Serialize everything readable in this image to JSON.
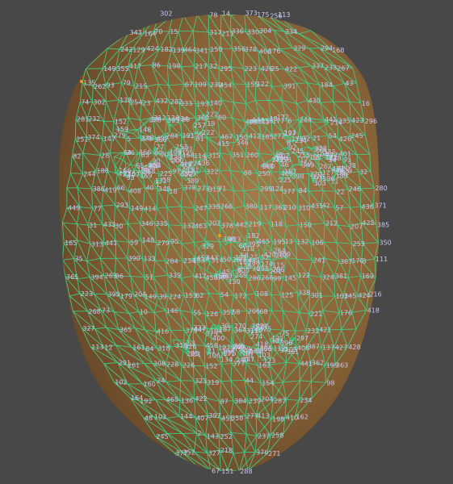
{
  "viewport": {
    "name": "3D face mesh viewport",
    "background": "#484848",
    "mesh_color": "#3fd08a",
    "skin_color": "#8a6438",
    "label_color": "#c9c6f2"
  },
  "vertex_labels": [
    "109",
    "10",
    "338",
    "67",
    "297",
    "103",
    "69",
    "108",
    "151",
    "337",
    "299",
    "332",
    "54",
    "104",
    "333",
    "284",
    "68",
    "105",
    "66",
    "107",
    "9",
    "336",
    "296",
    "334",
    "298",
    "63",
    "52",
    "65",
    "55",
    "8",
    "285",
    "295",
    "282",
    "293",
    "21",
    "71",
    "70",
    "46",
    "53",
    "222",
    "221",
    "193",
    "168",
    "417",
    "441",
    "442",
    "443",
    "444",
    "301",
    "251",
    "162",
    "139",
    "156",
    "124",
    "225",
    "224",
    "223",
    "351",
    "419",
    "413",
    "441",
    "286",
    "258",
    "257",
    "260",
    "467",
    "389",
    "127",
    "143",
    "35",
    "226",
    "113",
    "188",
    "122",
    "6",
    "197",
    "412",
    "465",
    "357",
    "453",
    "359",
    "264",
    "340",
    "356",
    "234",
    "227",
    "111",
    "117",
    "118",
    "50",
    "101",
    "36",
    "205",
    "142",
    "203",
    "126",
    "198",
    "195",
    "5",
    "4",
    "281",
    "274",
    "93",
    "123",
    "137",
    "177",
    "215",
    "147",
    "187",
    "207",
    "206",
    "216",
    "92",
    "165",
    "167",
    "164",
    "393",
    "391",
    "322",
    "132",
    "58",
    "138",
    "192",
    "214",
    "212",
    "186",
    "57",
    "43",
    "202",
    "210",
    "204",
    "194",
    "211",
    "169",
    "170",
    "140",
    "172",
    "136",
    "135",
    "150",
    "149",
    "176",
    "148",
    "152",
    "377",
    "400",
    "378",
    "379",
    "365",
    "397",
    "288",
    "361",
    "323",
    "454",
    "447",
    "366",
    "376",
    "401",
    "433",
    "435",
    "416",
    "364",
    "367",
    "434",
    "430",
    "431",
    "394",
    "395",
    "369",
    "396",
    "175",
    "171",
    "199",
    "200",
    "18",
    "313",
    "421",
    "418",
    "424",
    "422",
    "273",
    "335",
    "406",
    "262",
    "428",
    "32",
    "208",
    "201",
    "83",
    "182",
    "106",
    "84",
    "17",
    "314",
    "405",
    "321",
    "375",
    "291",
    "287",
    "410",
    "436",
    "427",
    "411",
    "425",
    "426",
    "266",
    "423",
    "280",
    "352",
    "346",
    "345",
    "447",
    "346",
    "330",
    "329",
    "348",
    "349",
    "350",
    "451",
    "452",
    "453",
    "449",
    "450",
    "250",
    "309",
    "444",
    "448",
    "261",
    "255",
    "339",
    "254",
    "253",
    "252",
    "256",
    "341",
    "463",
    "414",
    "286",
    "258",
    "441",
    "442",
    "443",
    "12",
    "13",
    "14",
    "15",
    "16",
    "315",
    "316",
    "317",
    "402",
    "318",
    "324",
    "308",
    "319",
    "325",
    "307",
    "310",
    "311",
    "312",
    "267",
    "269",
    "270",
    "409",
    "408",
    "407",
    "415",
    "272",
    "271",
    "268",
    "302",
    "303",
    "304",
    "0",
    "37",
    "39",
    "40",
    "185",
    "61",
    "146",
    "91",
    "181",
    "84",
    "86",
    "87",
    "88",
    "95",
    "78",
    "191",
    "80",
    "81",
    "82",
    "38",
    "41",
    "42",
    "183",
    "62",
    "96",
    "89",
    "179",
    "90",
    "77",
    "76",
    "184",
    "74",
    "73",
    "72",
    "11",
    "302",
    "242",
    "20",
    "94",
    "2",
    "164",
    "326",
    "327",
    "294",
    "278",
    "279",
    "360",
    "363",
    "131",
    "134",
    "51",
    "45",
    "220",
    "237",
    "44",
    "1",
    "19",
    "125",
    "241",
    "238",
    "239",
    "79",
    "166",
    "218",
    "219",
    "48",
    "64",
    "98",
    "97",
    "99",
    "240",
    "75",
    "60",
    "235",
    "59",
    "166",
    "209",
    "49",
    "129",
    "102",
    "115",
    "131",
    "198",
    "3",
    "236",
    "217",
    "174",
    "196",
    "114",
    "128",
    "245",
    "188",
    "122",
    "245",
    "244",
    "233",
    "232",
    "231",
    "230",
    "229",
    "228",
    "31",
    "25",
    "110",
    "24",
    "23",
    "22",
    "26",
    "112",
    "243",
    "190",
    "56",
    "28",
    "27",
    "29",
    "30",
    "247",
    "113",
    "130",
    "33",
    "246",
    "161",
    "160",
    "159",
    "158",
    "157",
    "173",
    "133",
    "155",
    "154",
    "153",
    "145",
    "144",
    "163",
    "7",
    "263",
    "466",
    "388",
    "387",
    "386",
    "385",
    "384",
    "398",
    "362",
    "382",
    "381",
    "380",
    "374",
    "373",
    "390",
    "249",
    "27",
    "28",
    "29",
    "30",
    "225",
    "224",
    "223",
    "222",
    "221",
    "189",
    "244",
    "245",
    "193",
    "417",
    "351",
    "465",
    "464",
    "413",
    "412",
    "399",
    "437",
    "355",
    "371",
    "266",
    "329",
    "277",
    "343",
    "456",
    "420",
    "429",
    "279",
    "358",
    "327",
    "423",
    "426",
    "436",
    "432",
    "422",
    "424",
    "418",
    "406",
    "313",
    "18",
    "83",
    "182",
    "106",
    "204",
    "211",
    "32",
    "262",
    "431",
    "395",
    "378",
    "400",
    "152",
    "377",
    "396",
    "175",
    "171",
    "148",
    "176",
    "149",
    "150",
    "169",
    "136",
    "172",
    "58",
    "132",
    "93",
    "234",
    "127",
    "162",
    "21",
    "54",
    "103",
    "67",
    "109",
    "10",
    "338",
    "297",
    "332",
    "284",
    "251",
    "389",
    "356",
    "454",
    "323",
    "361",
    "288",
    "397",
    "365",
    "379",
    "378",
    "400",
    "377",
    "152",
    "148",
    "176",
    "149",
    "150",
    "136",
    "172",
    "58",
    "132",
    "93",
    "234",
    "127",
    "162",
    "21",
    "54"
  ]
}
